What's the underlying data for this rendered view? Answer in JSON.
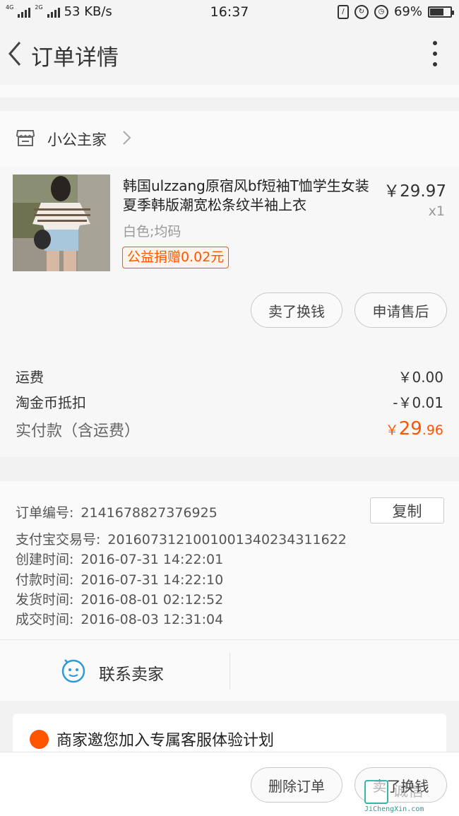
{
  "statusbar": {
    "net1": "4G",
    "net2": "2G",
    "speed": "53 KB/s",
    "time": "16:37",
    "battery": "69%",
    "battery_level": 0.69
  },
  "nav": {
    "title": "订单详情"
  },
  "shop": {
    "name": "小公主家"
  },
  "item": {
    "title": "韩国ulzzang原宿风bf短袖T恤学生女装夏季韩版潮宽松条纹半袖上衣",
    "price": "￥29.97",
    "qty": "x1",
    "sku": "白色;均码",
    "charity": "公益捐赠0.02元",
    "buttons": {
      "sell": "卖了换钱",
      "after_sale": "申请售后"
    }
  },
  "costs": {
    "shipping_label": "运费",
    "shipping": "￥0.00",
    "coin_label": "淘金币抵扣",
    "coin": "-￥0.01",
    "total_label": "实付款（含运费）",
    "total_symbol": "￥",
    "total_int": "29",
    "total_dec": ".96"
  },
  "info": {
    "order_no_label": "订单编号:",
    "order_no": "2141678827376925",
    "alipay_label": "支付宝交易号:",
    "alipay": "2016073121001001340234311622",
    "created_label": "创建时间:",
    "created": "2016-07-31 14:22:01",
    "paid_label": "付款时间:",
    "paid": "2016-07-31 14:22:10",
    "shipped_label": "发货时间:",
    "shipped": "2016-08-01 02:12:52",
    "done_label": "成交时间:",
    "done": "2016-08-03 12:31:04",
    "copy": "复制"
  },
  "contact": {
    "label": "联系卖家"
  },
  "promo": {
    "text": "商家邀您加入专属客服体验计划"
  },
  "bottom": {
    "delete": "删除订单",
    "sell": "卖了换钱"
  },
  "watermark": {
    "text": "诚信",
    "url": "JiChengXin.com"
  },
  "colors": {
    "accent": "#ff5500",
    "teal": "#2a9bd5"
  }
}
